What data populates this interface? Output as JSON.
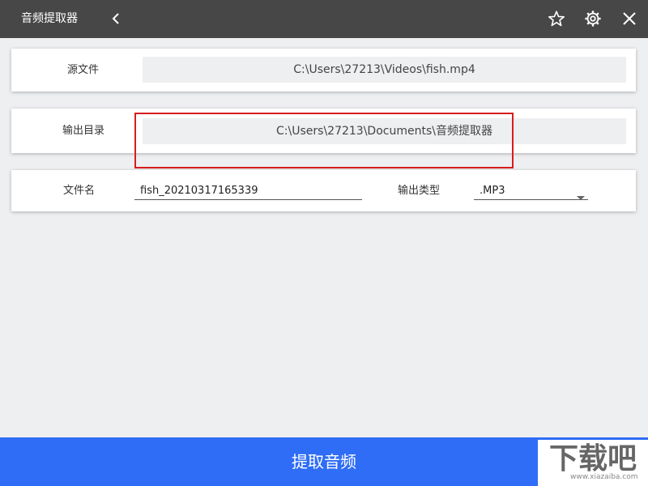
{
  "titlebar": {
    "title": "音频提取器",
    "icons": [
      "back-icon",
      "star-icon",
      "gear-icon",
      "close-icon"
    ]
  },
  "source_card": {
    "label": "源文件",
    "value": "C:\\Users\\27213\\Videos\\fish.mp4"
  },
  "output_card": {
    "label": "输出目录",
    "value": "C:\\Users\\27213\\Documents\\音频提取器"
  },
  "options_card": {
    "filename_label": "文件名",
    "filename_value": "fish_20210317165339",
    "type_label": "输出类型",
    "type_value": ".MP3"
  },
  "action": {
    "extract_label": "提取音频"
  },
  "watermark": {
    "text": "下载吧",
    "subtext": "www.xiazaiba.com"
  },
  "colors": {
    "titlebar": "#474747",
    "background": "#eeeff1",
    "accent": "#2f6df6",
    "highlight": "#d61d1d"
  }
}
